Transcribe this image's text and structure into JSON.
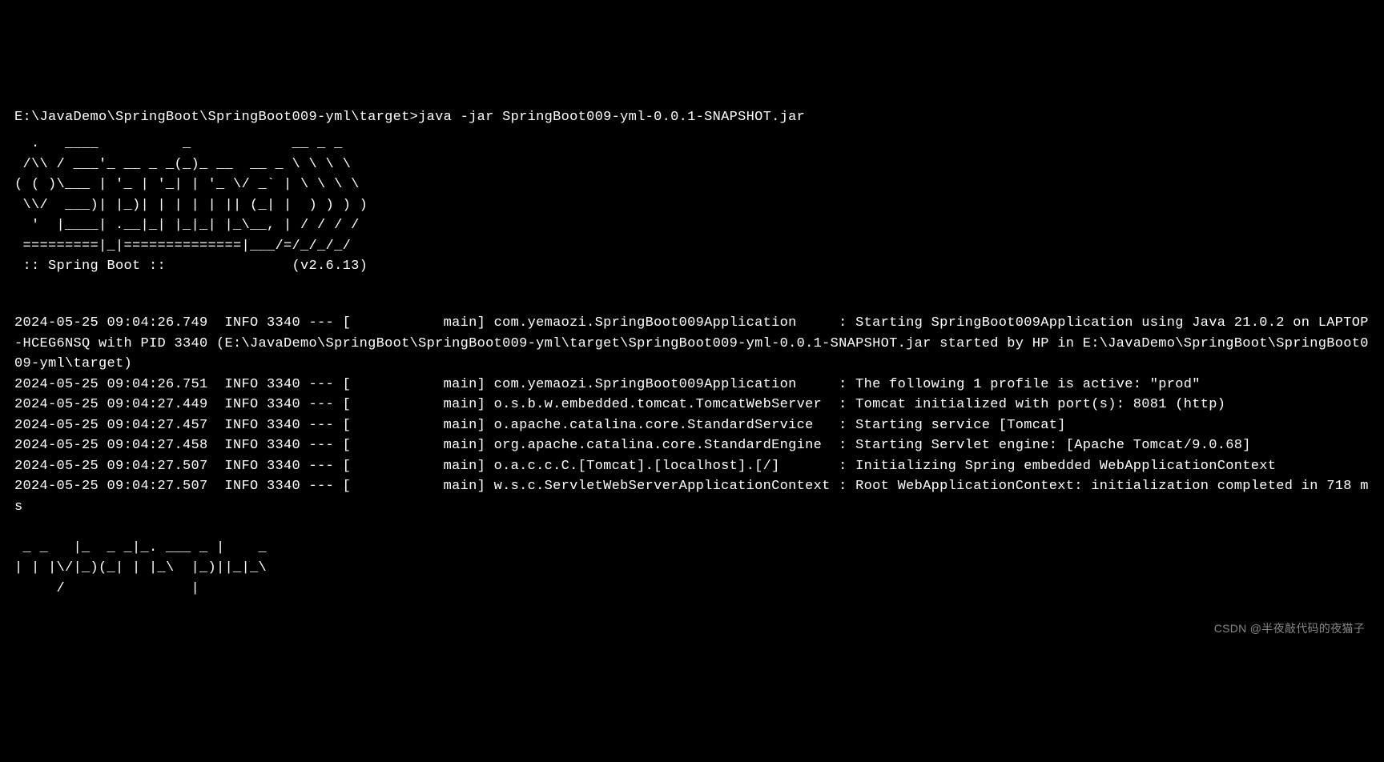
{
  "terminal": {
    "prompt": "E:\\JavaDemo\\SpringBoot\\SpringBoot009-yml\\target>",
    "command": "java -jar SpringBoot009-yml-0.0.1-SNAPSHOT.jar",
    "spring_banner": "  .   ____          _            __ _ _\n /\\\\ / ___'_ __ _ _(_)_ __  __ _ \\ \\ \\ \\\n( ( )\\___ | '_ | '_| | '_ \\/ _` | \\ \\ \\ \\\n \\\\/  ___)| |_)| | | | | || (_| |  ) ) ) )\n  '  |____| .__|_| |_|_| |_\\__, | / / / /\n =========|_|==============|___/=/_/_/_/\n :: Spring Boot ::               (v2.6.13)",
    "log_lines": [
      "2024-05-25 09:04:26.749  INFO 3340 --- [           main] com.yemaozi.SpringBoot009Application     : Starting SpringBoot009Application using Java 21.0.2 on LAPTOP-HCEG6NSQ with PID 3340 (E:\\JavaDemo\\SpringBoot\\SpringBoot009-yml\\target\\SpringBoot009-yml-0.0.1-SNAPSHOT.jar started by HP in E:\\JavaDemo\\SpringBoot\\SpringBoot009-yml\\target)",
      "2024-05-25 09:04:26.751  INFO 3340 --- [           main] com.yemaozi.SpringBoot009Application     : The following 1 profile is active: \"prod\"",
      "2024-05-25 09:04:27.449  INFO 3340 --- [           main] o.s.b.w.embedded.tomcat.TomcatWebServer  : Tomcat initialized with port(s): 8081 (http)",
      "2024-05-25 09:04:27.457  INFO 3340 --- [           main] o.apache.catalina.core.StandardService   : Starting service [Tomcat]",
      "2024-05-25 09:04:27.458  INFO 3340 --- [           main] org.apache.catalina.core.StandardEngine  : Starting Servlet engine: [Apache Tomcat/9.0.68]",
      "2024-05-25 09:04:27.507  INFO 3340 --- [           main] o.a.c.c.C.[Tomcat].[localhost].[/]       : Initializing Spring embedded WebApplicationContext",
      "2024-05-25 09:04:27.507  INFO 3340 --- [           main] w.s.c.ServletWebServerApplicationContext : Root WebApplicationContext: initialization completed in 718 ms"
    ],
    "mybatis_banner": " _ _   |_  _ _|_. ___ _ |    _\n| | |\\/|_)(_| | |_\\  |_)||_|_\\\n     /               |"
  },
  "watermark": "CSDN @半夜敲代码的夜猫子"
}
